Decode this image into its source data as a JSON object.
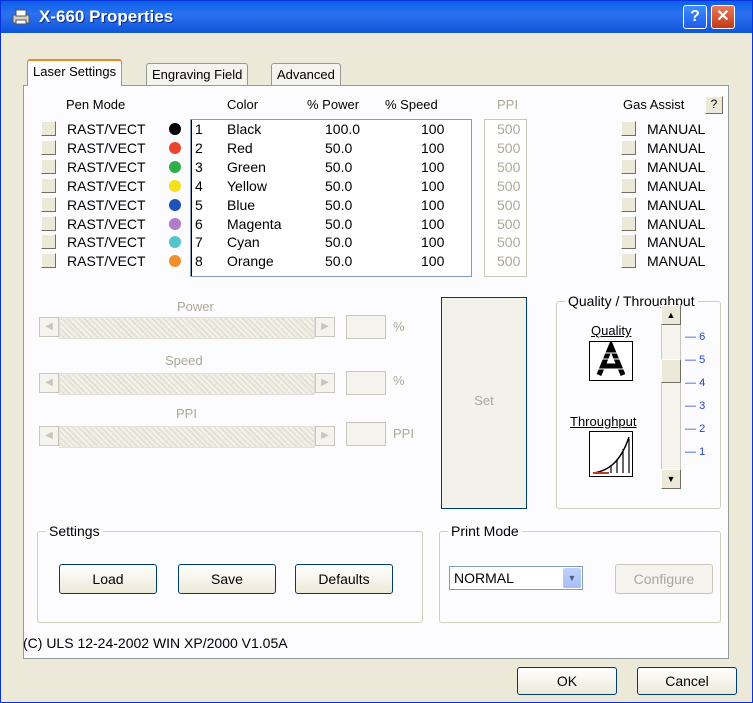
{
  "window": {
    "title": "X-660 Properties",
    "help_label": "?",
    "close_label": "✕"
  },
  "tabs": [
    {
      "label": "Laser Settings"
    },
    {
      "label": "Engraving Field"
    },
    {
      "label": "Advanced"
    }
  ],
  "headers": {
    "pen_mode": "Pen Mode",
    "color": "Color",
    "power": "% Power",
    "speed": "% Speed",
    "ppi": "PPI",
    "gas_assist": "Gas Assist",
    "help": "?"
  },
  "pens": [
    {
      "mode": "RAST/VECT",
      "num": "1",
      "name": "Black",
      "power": "100.0",
      "speed": "100",
      "ppi": "500",
      "gas": "MANUAL",
      "color": "#000000"
    },
    {
      "mode": "RAST/VECT",
      "num": "2",
      "name": "Red",
      "power": "50.0",
      "speed": "100",
      "ppi": "500",
      "gas": "MANUAL",
      "color": "#e8452e"
    },
    {
      "mode": "RAST/VECT",
      "num": "3",
      "name": "Green",
      "power": "50.0",
      "speed": "100",
      "ppi": "500",
      "gas": "MANUAL",
      "color": "#2fae48"
    },
    {
      "mode": "RAST/VECT",
      "num": "4",
      "name": "Yellow",
      "power": "50.0",
      "speed": "100",
      "ppi": "500",
      "gas": "MANUAL",
      "color": "#f2e11b"
    },
    {
      "mode": "RAST/VECT",
      "num": "5",
      "name": "Blue",
      "power": "50.0",
      "speed": "100",
      "ppi": "500",
      "gas": "MANUAL",
      "color": "#1f52b8"
    },
    {
      "mode": "RAST/VECT",
      "num": "6",
      "name": "Magenta",
      "power": "50.0",
      "speed": "100",
      "ppi": "500",
      "gas": "MANUAL",
      "color": "#b07cc8"
    },
    {
      "mode": "RAST/VECT",
      "num": "7",
      "name": "Cyan",
      "power": "50.0",
      "speed": "100",
      "ppi": "500",
      "gas": "MANUAL",
      "color": "#55c4cf"
    },
    {
      "mode": "RAST/VECT",
      "num": "8",
      "name": "Orange",
      "power": "50.0",
      "speed": "100",
      "ppi": "500",
      "gas": "MANUAL",
      "color": "#f0902a"
    }
  ],
  "sliders": {
    "power": {
      "label": "Power",
      "unit": "%"
    },
    "speed": {
      "label": "Speed",
      "unit": "%"
    },
    "ppi": {
      "label": "PPI",
      "unit": "PPI"
    },
    "set_label": "Set"
  },
  "quality": {
    "title": "Quality / Throughput",
    "quality_label": "Quality",
    "throughput_label": "Throughput",
    "ticks": [
      "6",
      "5",
      "4",
      "3",
      "2",
      "1"
    ],
    "selected": "5"
  },
  "settings": {
    "title": "Settings",
    "load": "Load",
    "save": "Save",
    "defaults": "Defaults"
  },
  "print_mode": {
    "title": "Print Mode",
    "value": "NORMAL",
    "configure": "Configure"
  },
  "footer": {
    "version": "(C) ULS 12-24-2002 WIN XP/2000 V1.05A"
  },
  "buttons": {
    "ok": "OK",
    "cancel": "Cancel"
  }
}
